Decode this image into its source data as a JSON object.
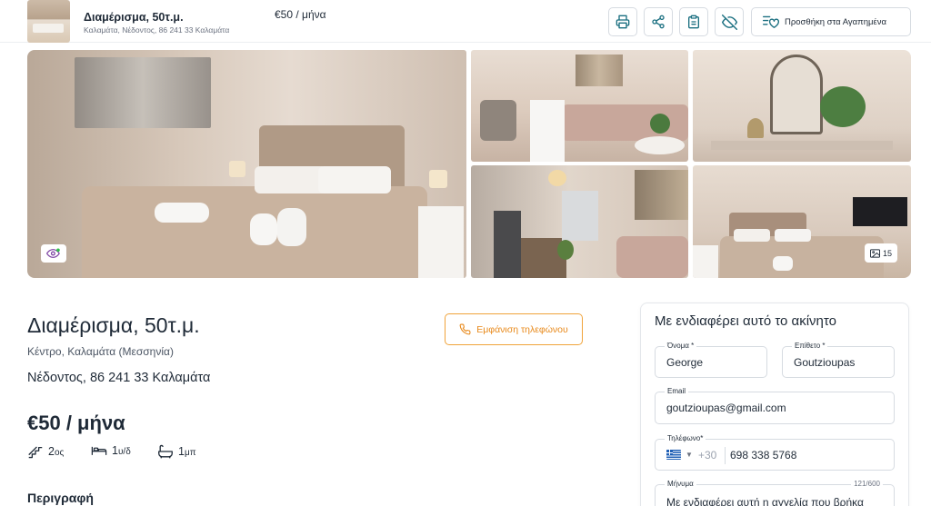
{
  "topbar": {
    "title": "Διαμέρισμα, 50τ.μ.",
    "subtitle": "Καλαμάτα, Νέδοντος, 86 241 33 Καλαμάτα",
    "price": "€50 / μήνα",
    "favorites_label": "Προσθήκη στα Αγαπημένα",
    "icons": [
      "print-icon",
      "share-icon",
      "clipboard-icon",
      "eye-off-icon",
      "heart-list-icon"
    ]
  },
  "gallery": {
    "photo_count": "15"
  },
  "listing": {
    "title": "Διαμέρισμα, 50τ.μ.",
    "location": "Κέντρο, Καλαμάτα (Μεσσηνία)",
    "address": "Νέδοντος, 86 241 33 Καλαμάτα",
    "price": "€50 / μήνα",
    "floor_value": "2",
    "floor_unit": "ος",
    "bedrooms_value": "1",
    "bedrooms_unit": "υ/δ",
    "bathrooms_value": "1",
    "bathrooms_unit": "μπ",
    "description_heading": "Περιγραφή",
    "show_phone_label": "Εμφάνιση τηλεφώνου"
  },
  "contact_form": {
    "heading": "Με ενδιαφέρει αυτό το ακίνητο",
    "first_name_label": "Όνομα *",
    "first_name_value": "George",
    "last_name_label": "Επίθετο *",
    "last_name_value": "Goutzioupas",
    "email_label": "Email",
    "email_value": "goutzioupas@gmail.com",
    "phone_label": "Τηλέφωνο*",
    "phone_dial_code": "+30",
    "phone_value": "698 338 5768",
    "message_label": "Μήνυμα",
    "message_counter": "121/600",
    "message_value": "Με ενδιαφέρει αυτή η αγγελία που βρήκα"
  },
  "colors": {
    "accent": "#e8891a",
    "text": "#1f2a37",
    "border": "#d6dbe1",
    "icon_teal": "#1a6f80"
  }
}
